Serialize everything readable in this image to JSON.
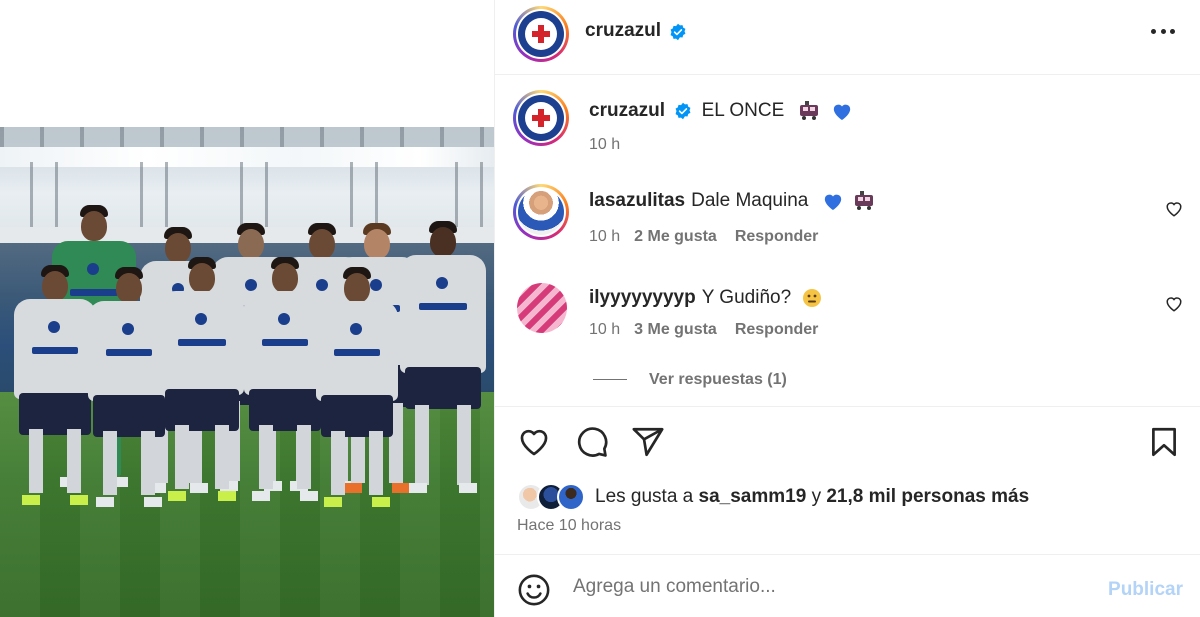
{
  "post": {
    "author": "cruzazul",
    "verified_icon": "verified-badge-icon",
    "more_icon": "more-options-icon"
  },
  "caption": {
    "author": "cruzazul",
    "text": "EL ONCE",
    "emojis": [
      "train-emoji",
      "blue-heart-emoji"
    ],
    "time": "10 h"
  },
  "comments": [
    {
      "user": "lasazulitas",
      "text": "Dale Maquina",
      "emojis": [
        "blue-heart-emoji",
        "train-emoji"
      ],
      "time": "10 h",
      "likes": "2 Me gusta",
      "reply_label": "Responder"
    },
    {
      "user": "ilyyyyyyyyp",
      "text": "Y Gudiño?",
      "emojis": [
        "face-emoji"
      ],
      "time": "10 h",
      "likes": "3 Me gusta",
      "reply_label": "Responder"
    }
  ],
  "view_replies": "Ver respuestas (1)",
  "actions": {
    "icons": [
      "heart-icon",
      "comment-icon",
      "share-icon",
      "bookmark-icon"
    ]
  },
  "likes": {
    "prefix": "Les gusta a ",
    "user": "sa_samm19",
    "middle": " y ",
    "count": "21,8 mil personas más"
  },
  "time_ago": "Hace 10 horas",
  "comment_box": {
    "placeholder": "Agrega un comentario...",
    "publish_label": "Publicar"
  },
  "colors": {
    "brand_blue": "#1d3f8f",
    "verified_blue": "#0095f6",
    "publish_disabled": "#b3d3f7",
    "muted_text": "#737373"
  }
}
